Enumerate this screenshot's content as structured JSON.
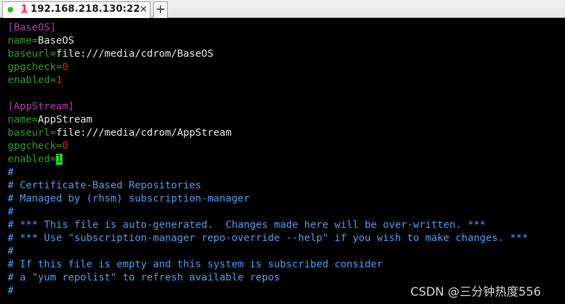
{
  "tab": {
    "number": "1",
    "title": "192.168.218.130:22",
    "close_glyph": "✕",
    "status_color": "#22c022"
  },
  "new_tab_glyph": "+",
  "lines": {
    "l1": {
      "section": "[BaseOS]"
    },
    "l2": {
      "key": "name",
      "eq": "=",
      "value": "BaseOS"
    },
    "l3": {
      "key": "baseurl",
      "eq": "=",
      "value": "file:///media/cdrom/BaseOS"
    },
    "l4": {
      "key": "gpgcheck",
      "eq": "=",
      "value": "0"
    },
    "l5": {
      "key": "enabled",
      "eq": "=",
      "value": "1"
    },
    "l6": {},
    "l7": {
      "section": "[AppStream]"
    },
    "l8": {
      "key": "name",
      "eq": "=",
      "value": "AppStream"
    },
    "l9": {
      "key": "baseurl",
      "eq": "=",
      "value": "file:///media/cdrom/AppStream"
    },
    "l10": {
      "key": "gpgcheck",
      "eq": "=",
      "value": "0"
    },
    "l11": {
      "key": "enabled",
      "eq": "=",
      "value": "1"
    },
    "l12": {
      "comment": "#"
    },
    "l13": {
      "comment": "# Certificate-Based Repositories"
    },
    "l14": {
      "comment": "# Managed by (rhsm) subscription-manager"
    },
    "l15": {
      "comment": "#"
    },
    "l16": {
      "comment": "# *** This file is auto-generated.  Changes made here will be over-written. ***"
    },
    "l17": {
      "comment": "# *** Use \"subscription-manager repo-override --help\" if you wish to make changes. ***"
    },
    "l18": {
      "comment": "#"
    },
    "l19": {
      "comment": "# If this file is empty and this system is subscribed consider"
    },
    "l20": {
      "comment": "# a \"yum repolist\" to refresh available repos"
    },
    "l21": {
      "comment": "#"
    }
  },
  "watermark": "CSDN @三分钟热度556",
  "colors": {
    "section": "#b63bb6",
    "key": "#2e9e2e",
    "number": "#e02828",
    "comment": "#4f9df5",
    "cursor": "#1fe81f"
  }
}
